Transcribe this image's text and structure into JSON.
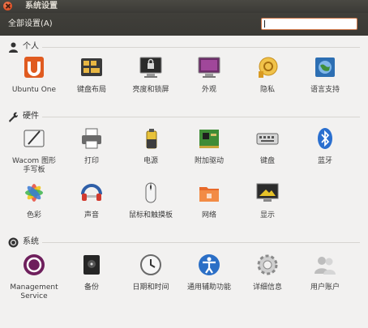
{
  "window": {
    "title": "系统设置"
  },
  "toolbar": {
    "all_settings_label": "全部设置(A)",
    "search_placeholder": ""
  },
  "sections": {
    "personal": {
      "title": "个人",
      "items": [
        {
          "label": "Ubuntu One",
          "icon": "ubuntu-one-icon"
        },
        {
          "label": "键盘布局",
          "icon": "keyboard-layout-icon"
        },
        {
          "label": "亮度和锁屏",
          "icon": "brightness-lock-icon"
        },
        {
          "label": "外观",
          "icon": "appearance-icon"
        },
        {
          "label": "隐私",
          "icon": "privacy-icon"
        },
        {
          "label": "语言支持",
          "icon": "language-support-icon"
        }
      ]
    },
    "hardware": {
      "title": "硬件",
      "items": [
        {
          "label": "Wacom 图形\n手写板",
          "icon": "wacom-tablet-icon"
        },
        {
          "label": "打印",
          "icon": "printer-icon"
        },
        {
          "label": "电源",
          "icon": "power-icon"
        },
        {
          "label": "附加驱动",
          "icon": "additional-drivers-icon"
        },
        {
          "label": "键盘",
          "icon": "keyboard-icon"
        },
        {
          "label": "蓝牙",
          "icon": "bluetooth-icon"
        },
        {
          "label": "色彩",
          "icon": "color-icon"
        },
        {
          "label": "声音",
          "icon": "sound-icon"
        },
        {
          "label": "鼠标和触摸板",
          "icon": "mouse-touchpad-icon"
        },
        {
          "label": "网络",
          "icon": "network-icon"
        },
        {
          "label": "显示",
          "icon": "display-icon"
        }
      ]
    },
    "system": {
      "title": "系统",
      "items": [
        {
          "label": "Management\nService",
          "icon": "management-service-icon"
        },
        {
          "label": "备份",
          "icon": "backup-icon"
        },
        {
          "label": "日期和时间",
          "icon": "date-time-icon"
        },
        {
          "label": "通用辅助功能",
          "icon": "accessibility-icon"
        },
        {
          "label": "详细信息",
          "icon": "details-icon"
        },
        {
          "label": "用户账户",
          "icon": "user-accounts-icon"
        }
      ]
    }
  }
}
